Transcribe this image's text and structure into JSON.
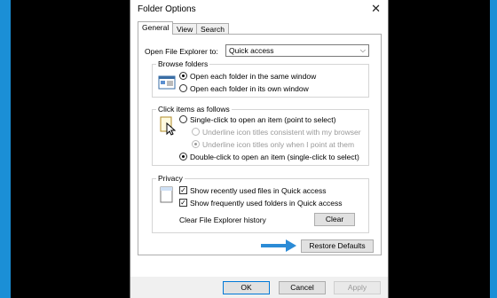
{
  "window": {
    "title": "Folder Options"
  },
  "tabs": [
    {
      "label": "General",
      "active": true
    },
    {
      "label": "View",
      "active": false
    },
    {
      "label": "Search",
      "active": false
    }
  ],
  "open_in": {
    "label": "Open File Explorer to:",
    "value": "Quick access"
  },
  "browse_folders": {
    "title": "Browse folders",
    "options": [
      {
        "label": "Open each folder in the same window",
        "checked": true
      },
      {
        "label": "Open each folder in its own window",
        "checked": false
      }
    ]
  },
  "click_items": {
    "title": "Click items as follows",
    "single": "Single-click to open an item (point to select)",
    "underline_browser": "Underline icon titles consistent with my browser",
    "underline_point": "Underline icon titles only when I point at them",
    "double": "Double-click to open an item (single-click to select)"
  },
  "privacy": {
    "title": "Privacy",
    "recent_files": "Show recently used files in Quick access",
    "frequent_folders": "Show frequently used folders in Quick access",
    "clear_label": "Clear File Explorer history",
    "clear_button": "Clear"
  },
  "restore_defaults": "Restore Defaults",
  "buttons": {
    "ok": "OK",
    "cancel": "Cancel",
    "apply": "Apply"
  },
  "colors": {
    "accent": "#1b8fd6",
    "arrow": "#2b8bd6"
  }
}
